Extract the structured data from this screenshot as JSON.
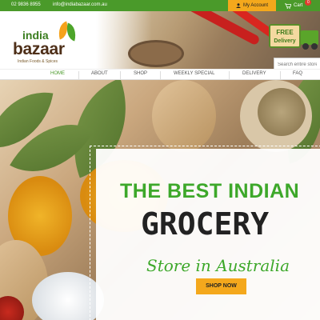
{
  "topbar": {
    "phone": "02 9836 8955",
    "email": "info@indiabazaar.com.au",
    "account_label": "My Account",
    "cart_label": "Cart",
    "cart_count": "0"
  },
  "logo": {
    "line1": "india",
    "line2": "bazaar",
    "tagline": "Indian Foods & Spices"
  },
  "delivery_badge": {
    "line1": "FREE",
    "line2": "Delivery"
  },
  "search": {
    "placeholder": "Search entire store"
  },
  "nav": {
    "items": [
      {
        "label": "HOME",
        "active": true
      },
      {
        "label": "ABOUT"
      },
      {
        "label": "SHOP"
      },
      {
        "label": "WEEKLY SPECIAL"
      },
      {
        "label": "DELIVERY"
      },
      {
        "label": "FAQ"
      }
    ]
  },
  "hero": {
    "line1": "THE BEST INDIAN",
    "line2": "GROCERY",
    "line3": "Store in Australia",
    "button": "SHOP NOW"
  },
  "colors": {
    "brand_green": "#4a9a2a",
    "accent_orange": "#f4a81c"
  }
}
